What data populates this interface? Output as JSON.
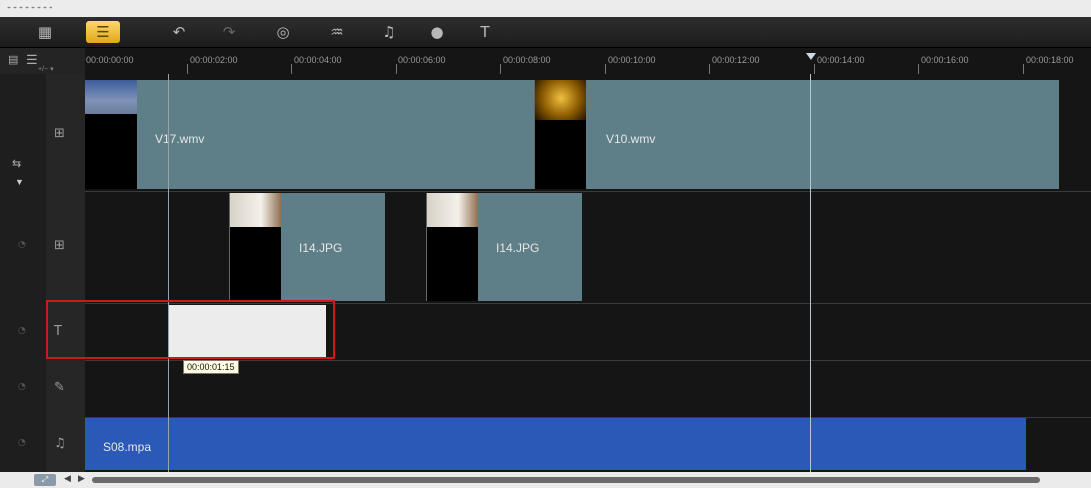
{
  "toolbar": {
    "buttons": [
      {
        "name": "storyboard-view-icon",
        "glyph": "▦"
      },
      {
        "name": "timeline-view-icon",
        "glyph": "☰"
      },
      {
        "name": "undo-icon",
        "glyph": "↶"
      },
      {
        "name": "redo-icon",
        "glyph": "↷"
      },
      {
        "name": "record-capture-icon",
        "glyph": "◎"
      },
      {
        "name": "sound-mixer-icon",
        "glyph": "♒"
      },
      {
        "name": "auto-music-icon",
        "glyph": "♫"
      },
      {
        "name": "motion-tracking-icon",
        "glyph": "●"
      },
      {
        "name": "subtitle-editor-icon",
        "glyph": "T"
      }
    ]
  },
  "ruler": {
    "ticks": [
      "00:00:00:00",
      "00:00:02:00",
      "00:00:04:00",
      "00:00:06:00",
      "00:00:08:00",
      "00:00:10:00",
      "00:00:12:00",
      "00:00:14:00",
      "00:00:16:00",
      "00:00:18:00"
    ]
  },
  "tracks": {
    "video_main": {
      "clip1_label": "V17.wmv",
      "clip2_label": "V10.wmv"
    },
    "overlay": {
      "clip1_label": "I14.JPG",
      "clip2_label": "I14.JPG"
    },
    "title": {
      "duration_tooltip": "00:00:01:15"
    },
    "music": {
      "clip_label": "S08.mpa"
    }
  },
  "colors": {
    "video_clip": "#5e7f87",
    "audio_clip": "#2a59b8",
    "selection": "#d01818",
    "active_button": "#f0c040"
  }
}
